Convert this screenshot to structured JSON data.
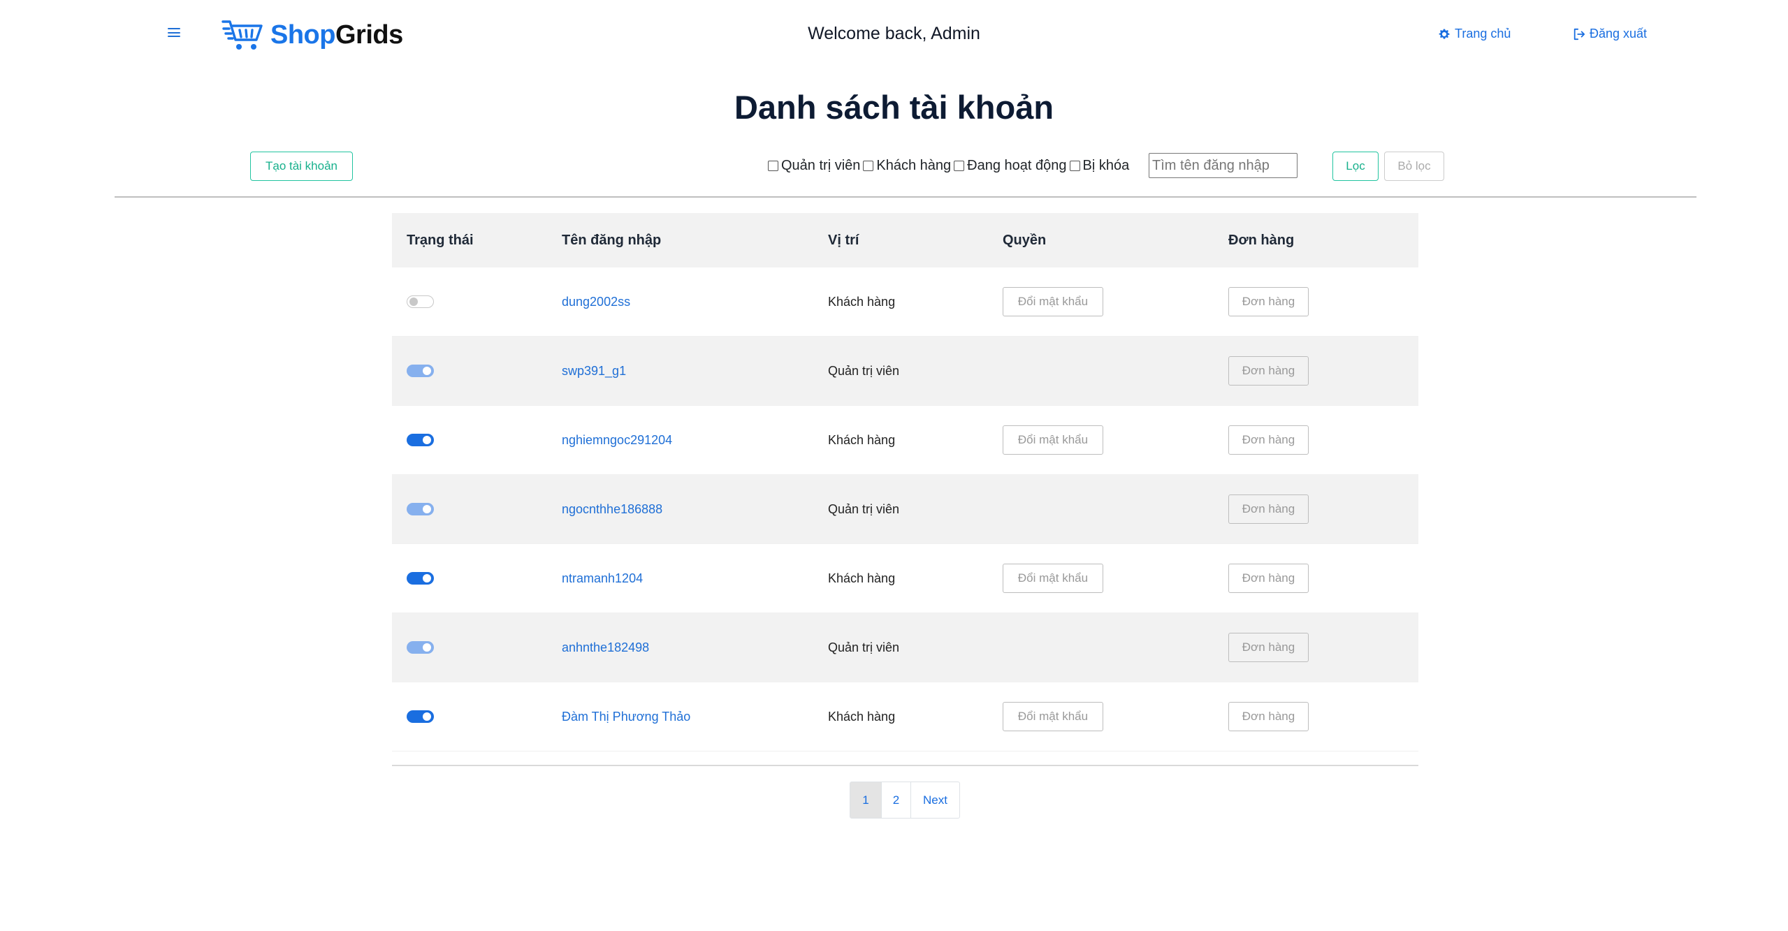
{
  "header": {
    "logo_shop": "Shop",
    "logo_grids": "Grids",
    "welcome": "Welcome back, Admin",
    "home_label": "Trang chủ",
    "logout_label": "Đăng xuất"
  },
  "page_title": "Danh sách tài khoản",
  "toolbar": {
    "create_label": "Tạo tài khoản",
    "filters": [
      "Quản trị viên",
      "Khách hàng",
      "Đang hoạt động",
      "Bị khóa"
    ],
    "search_placeholder": "Tìm tên đăng nhập",
    "filter_label": "Lọc",
    "clear_label": "Bỏ lọc"
  },
  "table": {
    "headers": [
      "Trạng thái",
      "Tên đăng nhập",
      "Vị trí",
      "Quyền",
      "Đơn hàng"
    ],
    "rows": [
      {
        "status": "off",
        "username": "dung2002ss",
        "role": "Khách hàng",
        "permission": "Đổi mật khẩu",
        "orders": "Đơn hàng"
      },
      {
        "status": "dim",
        "username": "swp391_g1",
        "role": "Quản trị viên",
        "permission": "",
        "orders": "Đơn hàng"
      },
      {
        "status": "on",
        "username": "nghiemngoc291204",
        "role": "Khách hàng",
        "permission": "Đổi mật khẩu",
        "orders": "Đơn hàng"
      },
      {
        "status": "dim",
        "username": "ngocnthhe186888",
        "role": "Quản trị viên",
        "permission": "",
        "orders": "Đơn hàng"
      },
      {
        "status": "on",
        "username": "ntramanh1204",
        "role": "Khách hàng",
        "permission": "Đổi mật khẩu",
        "orders": "Đơn hàng"
      },
      {
        "status": "dim",
        "username": "anhnthe182498",
        "role": "Quản trị viên",
        "permission": "",
        "orders": "Đơn hàng"
      },
      {
        "status": "on",
        "username": "Đàm Thị Phương Thảo",
        "role": "Khách hàng",
        "permission": "Đổi mật khẩu",
        "orders": "Đơn hàng"
      }
    ]
  },
  "pagination": {
    "pages": [
      "1",
      "2"
    ],
    "next_label": "Next",
    "active": "1"
  },
  "colors": {
    "accent": "#1a6ee0",
    "teal": "#22c4a0",
    "toggle_dim": "#86b0ee"
  }
}
